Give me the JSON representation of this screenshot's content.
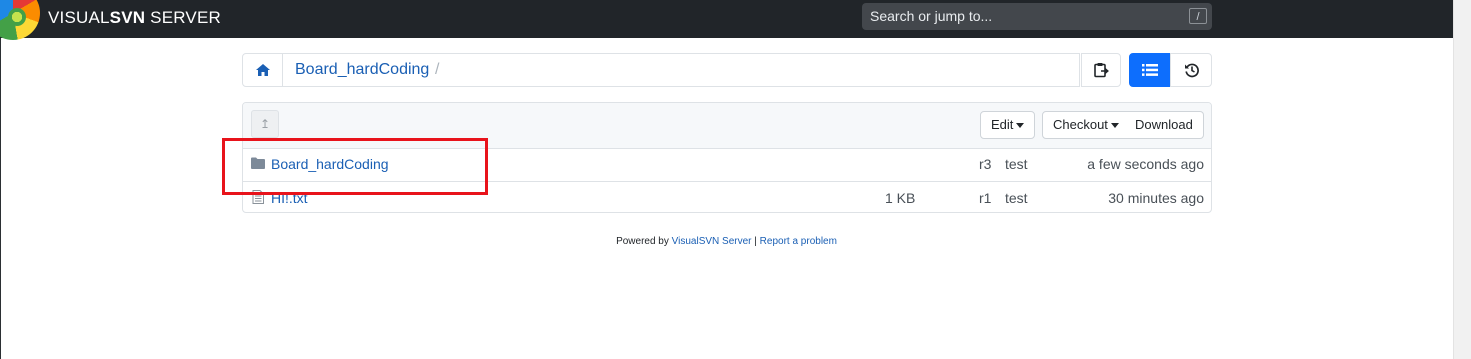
{
  "header": {
    "brand_prefix": "VISUAL",
    "brand_bold": "SVN",
    "brand_suffix": " SERVER",
    "search_placeholder": "Search or jump to...",
    "search_shortcut": "/"
  },
  "breadcrumb": {
    "home_icon": "home-icon",
    "repo": "Board_hardCoding",
    "separator": "/"
  },
  "toolbar": {
    "copy_icon": "clipboard-icon",
    "list_icon": "list-icon",
    "history_icon": "history-icon",
    "up_icon": "arrow-up-icon",
    "edit_label": "Edit",
    "checkout_label": "Checkout",
    "download_label": "Download"
  },
  "entries": [
    {
      "icon": "folder-icon",
      "name": "Board_hardCoding",
      "size": "",
      "revision": "r3",
      "author": "test",
      "modified": "a few seconds ago"
    },
    {
      "icon": "file-icon",
      "name": "HI!.txt",
      "size": "1 KB",
      "revision": "r1",
      "author": "test",
      "modified": "30 minutes ago"
    }
  ],
  "footer": {
    "prefix": "Powered by ",
    "product_link": "VisualSVN Server",
    "divider": " | ",
    "report_link": "Report a problem"
  },
  "colors": {
    "navbar": "#212529",
    "link": "#1a5fb4",
    "primary": "#0d6efd",
    "annotation": "#e8131b"
  }
}
